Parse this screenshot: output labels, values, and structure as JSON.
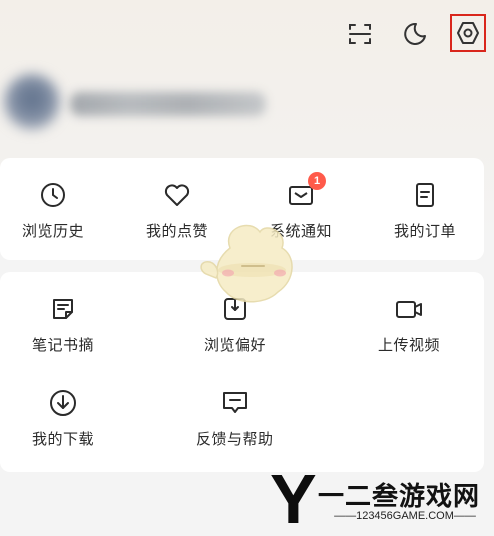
{
  "header": {
    "icons": [
      "scan-icon",
      "moon-icon",
      "settings-icon"
    ],
    "highlight_color": "#d9261c"
  },
  "quick_menu": {
    "items": [
      {
        "label": "浏览历史",
        "icon": "clock-icon"
      },
      {
        "label": "我的点赞",
        "icon": "heart-icon"
      },
      {
        "label": "系统通知",
        "icon": "mail-icon",
        "badge": "1"
      },
      {
        "label": "我的订单",
        "icon": "document-icon"
      }
    ]
  },
  "tools": {
    "items": [
      {
        "label": "笔记书摘",
        "icon": "note-icon"
      },
      {
        "label": "浏览偏好",
        "icon": "preference-icon"
      },
      {
        "label": "上传视频",
        "icon": "video-camera-icon"
      },
      {
        "label": "我的下载",
        "icon": "download-icon"
      },
      {
        "label": "反馈与帮助",
        "icon": "feedback-icon"
      }
    ]
  },
  "watermark": {
    "logo_letter": "Y",
    "title": "一二叁游戏网",
    "subtitle": "——123456GAME.COM——"
  },
  "colors": {
    "badge": "#ff5a4a",
    "card": "#ffffff",
    "background": "#f4f4f4"
  }
}
